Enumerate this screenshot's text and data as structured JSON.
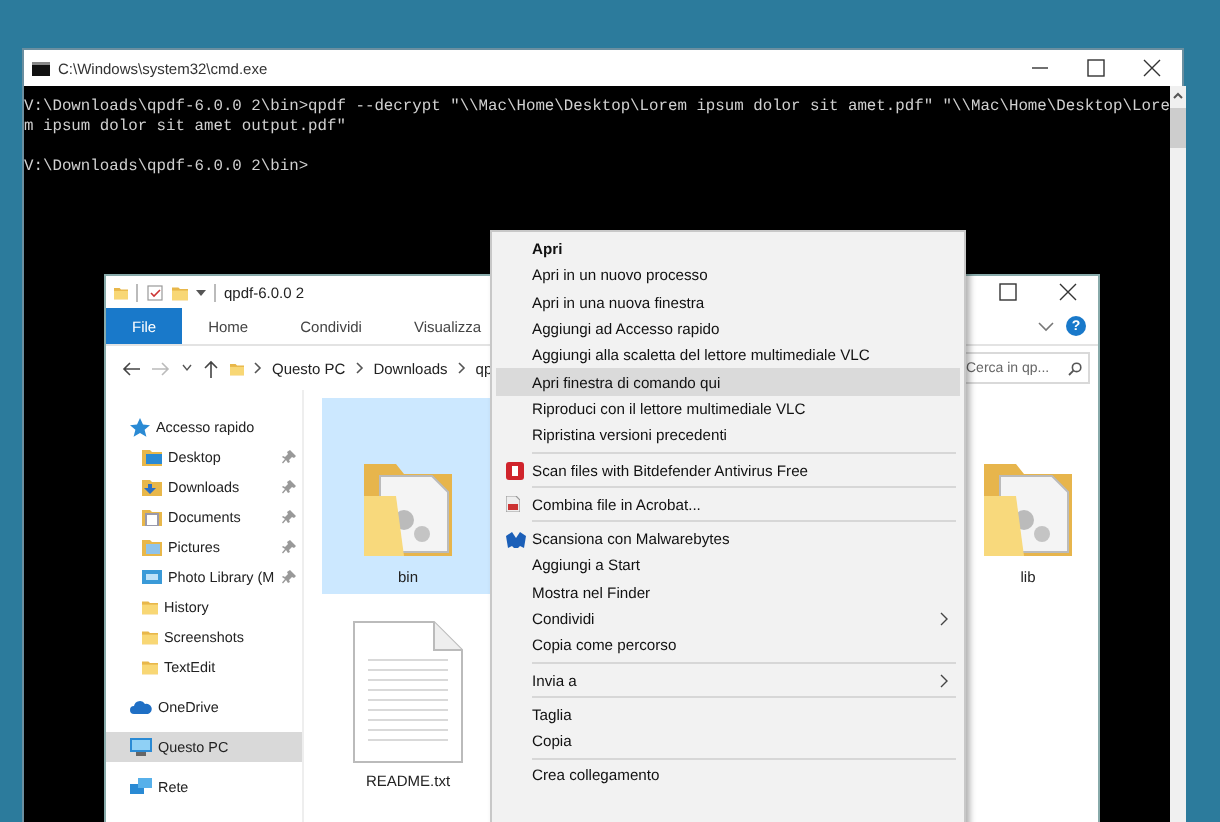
{
  "console_window": {
    "title": "C:\\Windows\\system32\\cmd.exe",
    "blocks": [
      {
        "lines": [
          "V:\\Downloads\\qpdf-6.0.0 2\\bin>qpdf --decrypt \"\\\\Mac\\Home\\Desktop\\Lorem ipsum dolor sit amet.pdf\" \"\\\\Mac\\Home\\Desktop\\Lore",
          "m ipsum dolor sit amet output.pdf\""
        ]
      },
      {
        "lines": [
          "V:\\Downloads\\qpdf-6.0.0 2\\bin>"
        ]
      }
    ]
  },
  "explorer_window": {
    "title": "qpdf-6.0.0 2",
    "ribbon_tabs": [
      {
        "label": "File",
        "selected": true
      },
      {
        "label": "Home",
        "selected": false
      },
      {
        "label": "Condividi",
        "selected": false
      },
      {
        "label": "Visualizza",
        "selected": false
      }
    ],
    "help": "?",
    "breadcrumb": [
      "Questo PC",
      "Downloads",
      "qp"
    ],
    "search": {
      "placeholder": "Cerca in qp..."
    },
    "navigation": [
      {
        "label": "Accesso rapido",
        "kind": "star",
        "pinned": false,
        "selected": false,
        "children": [
          {
            "label": "Desktop",
            "kind": "desktop",
            "pinned": true,
            "selected": false
          },
          {
            "label": "Downloads",
            "kind": "download",
            "pinned": true,
            "selected": false
          },
          {
            "label": "Documents",
            "kind": "documents",
            "pinned": true,
            "selected": false
          },
          {
            "label": "Pictures",
            "kind": "pictures",
            "pinned": true,
            "selected": false
          },
          {
            "label": "Photo Library (M",
            "kind": "photos",
            "pinned": true,
            "selected": false
          },
          {
            "label": "History",
            "kind": "folder",
            "pinned": false,
            "selected": false
          },
          {
            "label": "Screenshots",
            "kind": "folder",
            "pinned": false,
            "selected": false
          },
          {
            "label": "TextEdit",
            "kind": "folder",
            "pinned": false,
            "selected": false
          }
        ]
      },
      {
        "label": "OneDrive",
        "kind": "cloud",
        "pinned": false,
        "selected": false
      },
      {
        "label": "Questo PC",
        "kind": "computer",
        "pinned": false,
        "selected": true
      },
      {
        "label": "Rete",
        "kind": "network",
        "pinned": false,
        "selected": false
      }
    ],
    "files": [
      {
        "name": "bin",
        "kind": "folder",
        "selected": true
      },
      {
        "name": "README.txt",
        "kind": "text",
        "selected": false
      },
      {
        "name": "lib",
        "kind": "folder",
        "selected": false
      }
    ]
  },
  "context_menu": {
    "groups": [
      [
        {
          "label": "Apri",
          "kind": "text",
          "default": true,
          "selected": false,
          "submenu": false
        },
        {
          "label": "Apri in un nuovo processo",
          "kind": "text",
          "default": false,
          "selected": false,
          "submenu": false
        },
        {
          "label": "Apri in una nuova finestra",
          "kind": "text",
          "default": false,
          "selected": false,
          "submenu": false
        },
        {
          "label": "Aggiungi ad Accesso rapido",
          "kind": "text",
          "default": false,
          "selected": false,
          "submenu": false
        },
        {
          "label": "Aggiungi alla scaletta del lettore multimediale VLC",
          "kind": "text",
          "default": false,
          "selected": false,
          "submenu": false
        },
        {
          "label": "Apri finestra di comando qui",
          "kind": "text",
          "default": false,
          "selected": true,
          "submenu": false
        },
        {
          "label": "Riproduci con il lettore multimediale VLC",
          "kind": "text",
          "default": false,
          "selected": false,
          "submenu": false
        },
        {
          "label": "Ripristina versioni precedenti",
          "kind": "text",
          "default": false,
          "selected": false,
          "submenu": false
        }
      ],
      [
        {
          "label": "Scan files with Bitdefender Antivirus Free",
          "kind": "shield",
          "default": false,
          "selected": false,
          "submenu": false
        }
      ],
      [
        {
          "label": "Combina file in Acrobat...",
          "kind": "document",
          "default": false,
          "selected": false,
          "submenu": false
        }
      ],
      [
        {
          "label": "Scansiona con Malwarebytes",
          "kind": "wing",
          "default": false,
          "selected": false,
          "submenu": false
        },
        {
          "label": "Aggiungi a Start",
          "kind": "text",
          "default": false,
          "selected": false,
          "submenu": false
        },
        {
          "label": "Mostra nel Finder",
          "kind": "text",
          "default": false,
          "selected": false,
          "submenu": false
        },
        {
          "label": "Condividi",
          "kind": "text",
          "default": false,
          "selected": false,
          "submenu": true
        },
        {
          "label": "Copia come percorso",
          "kind": "text",
          "default": false,
          "selected": false,
          "submenu": false
        }
      ],
      [
        {
          "label": "Invia a",
          "kind": "text",
          "default": false,
          "selected": false,
          "submenu": true
        }
      ],
      [
        {
          "label": "Taglia",
          "kind": "text",
          "default": false,
          "selected": false,
          "submenu": false
        },
        {
          "label": "Copia",
          "kind": "text",
          "default": false,
          "selected": false,
          "submenu": false
        }
      ],
      [
        {
          "label": "Crea collegamento",
          "kind": "text",
          "default": false,
          "selected": false,
          "submenu": false
        }
      ]
    ]
  }
}
